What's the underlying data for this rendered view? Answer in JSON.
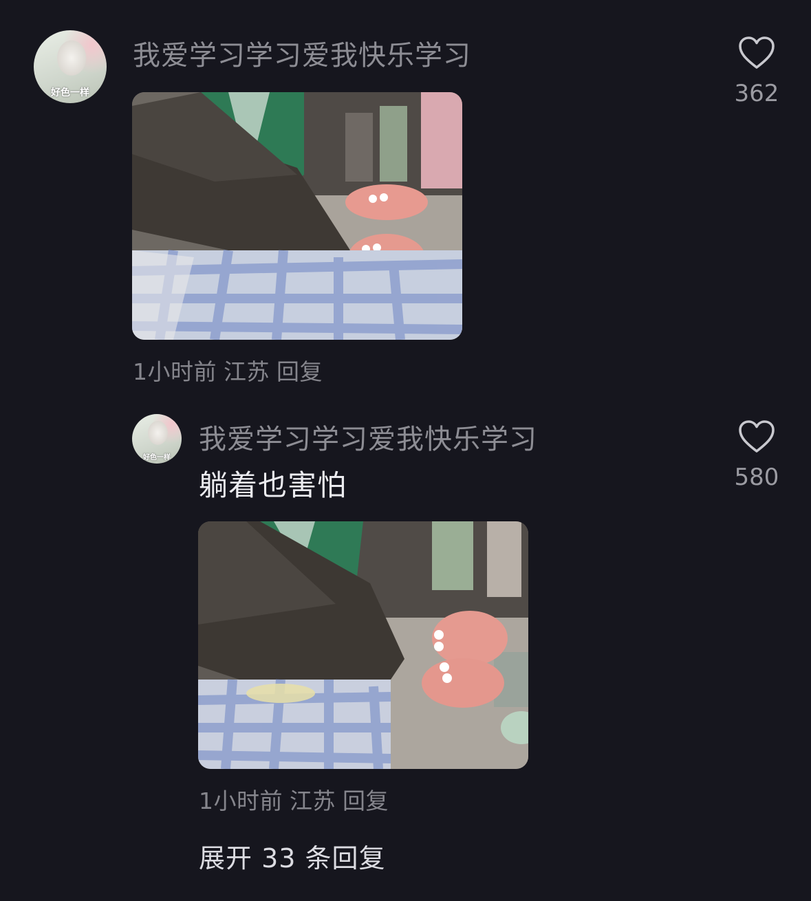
{
  "comment": {
    "username": "我爱学习学习爱我快乐学习",
    "avatar_caption": "好色一样",
    "meta": {
      "time": "1小时前",
      "location": "江苏",
      "reply": "回复"
    },
    "likes": "362",
    "like_icon": "heart-outline-icon"
  },
  "reply": {
    "username": "我爱学习学习爱我快乐学习",
    "avatar_caption": "好色一样",
    "text": "躺着也害怕",
    "meta": {
      "time": "1小时前",
      "location": "江苏",
      "reply": "回复"
    },
    "likes": "580",
    "like_icon": "heart-outline-icon"
  },
  "expand_replies": "展开 33 条回复",
  "colors": {
    "background": "#16161e",
    "username": "#8d8d94",
    "text": "#ececf0",
    "meta": "#85858c"
  }
}
